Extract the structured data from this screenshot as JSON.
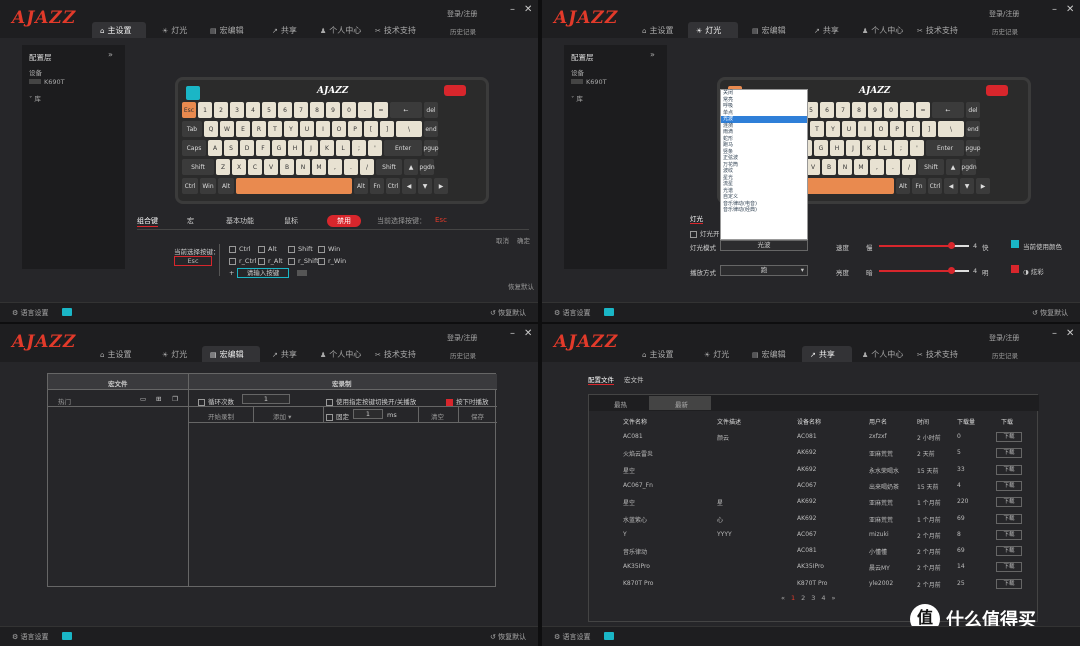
{
  "app": {
    "logo": "AJAZZ",
    "login": "登录/注册",
    "history": "历史记录",
    "lang": "语言设置",
    "restore": "恢复默认",
    "tabs": [
      "主设置",
      "灯光",
      "宏编辑",
      "共享",
      "个人中心",
      "技术支持"
    ]
  },
  "p1": {
    "config_layer": "配置层",
    "device": "设备",
    "model": "K690T",
    "lib": "库",
    "keyboard_logo": "AJAZZ",
    "subtabs": [
      "组合键",
      "宏",
      "基本功能",
      "鼠标",
      "禁用",
      "当前选择按键：",
      "Esc"
    ],
    "current_key_label": "当前选择按键：",
    "current_key": "Esc",
    "modifiers": [
      "Ctrl",
      "Alt",
      "Shift",
      "Win",
      "r_Ctrl",
      "r_Alt",
      "r_Shift",
      "r_Win"
    ],
    "input_btn": "请输入按键",
    "cancel": "取消",
    "confirm": "确定",
    "restore_default": "恢复默认",
    "rows": [
      [
        "Esc",
        "1",
        "2",
        "3",
        "4",
        "5",
        "6",
        "7",
        "8",
        "9",
        "0",
        "-",
        "=",
        "←",
        "del"
      ],
      [
        "Tab",
        "Q",
        "W",
        "E",
        "R",
        "T",
        "Y",
        "U",
        "I",
        "O",
        "P",
        "[",
        "]",
        "\\",
        "end"
      ],
      [
        "Caps",
        "A",
        "S",
        "D",
        "F",
        "G",
        "H",
        "J",
        "K",
        "L",
        ";",
        "'",
        "Enter",
        "pgup"
      ],
      [
        "Shift",
        "Z",
        "X",
        "C",
        "V",
        "B",
        "N",
        "M",
        ",",
        ".",
        "/",
        "Shift",
        "▲",
        "pgdn"
      ],
      [
        "Ctrl",
        "Win",
        "Alt",
        "",
        "Alt",
        "Fn",
        "Ctrl",
        "◀",
        "▼",
        "▶"
      ]
    ]
  },
  "p2": {
    "config_layer": "配置层",
    "device": "设备",
    "model": "K690T",
    "lib": "库",
    "effects": [
      "常亮",
      "呼吸",
      "单点",
      "光波",
      "涟漪",
      "雨滴",
      "蛇形",
      "跑马",
      "竖条",
      "正弦波",
      "万花筒",
      "波纹",
      "星光",
      "流星",
      "光谱",
      "自定义",
      "音乐律动(电音)",
      "音乐律动(经典)",
      "关闭"
    ],
    "effects_head": [
      "关闭",
      "常亮",
      "呼吸",
      "单点"
    ],
    "selected_effect": "光波",
    "light_label": "灯光",
    "light_toggle": "灯光开",
    "mode_label": "灯光模式",
    "mode_value": "光波",
    "play_label": "播放方式",
    "play_value": "跑",
    "speed_label": "速度",
    "slow": "慢",
    "fast": "快",
    "speed": 4,
    "bright_label": "亮度",
    "dark": "暗",
    "bright": "明",
    "brightness": 4,
    "use_color": "当前使用颜色",
    "colorful": "炫彩"
  },
  "p3": {
    "macro_file": "宏文件",
    "macro_record": "宏录制",
    "hot": "热门",
    "loop_label": "循环次数",
    "loop_value": "1",
    "opt1": "使用指定按键切换开/关播放",
    "opt2": "按下时播放",
    "start_record": "开始录制",
    "add": "添加 ▾",
    "fixed": "固定",
    "fixed_value": "1",
    "ms": "ms",
    "clear": "清空",
    "save": "保存"
  },
  "p4": {
    "tab1": "配置文件",
    "tab2": "宏文件",
    "sort1": "最热",
    "sort2": "最新",
    "cols": [
      "文件名称",
      "文件描述",
      "设备名称",
      "用户名",
      "时间",
      "下载量",
      "下载"
    ],
    "rows": [
      [
        "AC081",
        "颜云",
        "AC081",
        "zxfzxf",
        "2 小时前",
        "0"
      ],
      [
        "火焰云雷炎",
        "",
        "AK692",
        "亚麻荒荒",
        "2 天前",
        "5"
      ],
      [
        "星空",
        "",
        "AK692",
        "永水荣喝水",
        "15 天前",
        "33"
      ],
      [
        "AC067_Fn",
        "",
        "AC067",
        "出来喝奶茶",
        "15 天前",
        "4"
      ],
      [
        "星空",
        "星",
        "AK692",
        "亚麻荒荒",
        "1 个月前",
        "220"
      ],
      [
        "水蓝紫心",
        "心",
        "AK692",
        "亚麻荒荒",
        "1 个月前",
        "69"
      ],
      [
        "Y",
        "YYYY",
        "AC067",
        "mizuki",
        "2 个月前",
        "8"
      ],
      [
        "音乐律动",
        "",
        "AC081",
        "小懂懂",
        "2 个月前",
        "69"
      ],
      [
        "AK35IPro",
        "",
        "AK35IPro",
        "晨云MY",
        "2 个月前",
        "14"
      ],
      [
        "K870T Pro",
        "",
        "K870T Pro",
        "yle2002",
        "2 个月前",
        "25"
      ]
    ],
    "download": "下载",
    "pages": [
      "«",
      "1",
      "2",
      "3",
      "4",
      "»"
    ],
    "watermark": "什么值得买"
  }
}
